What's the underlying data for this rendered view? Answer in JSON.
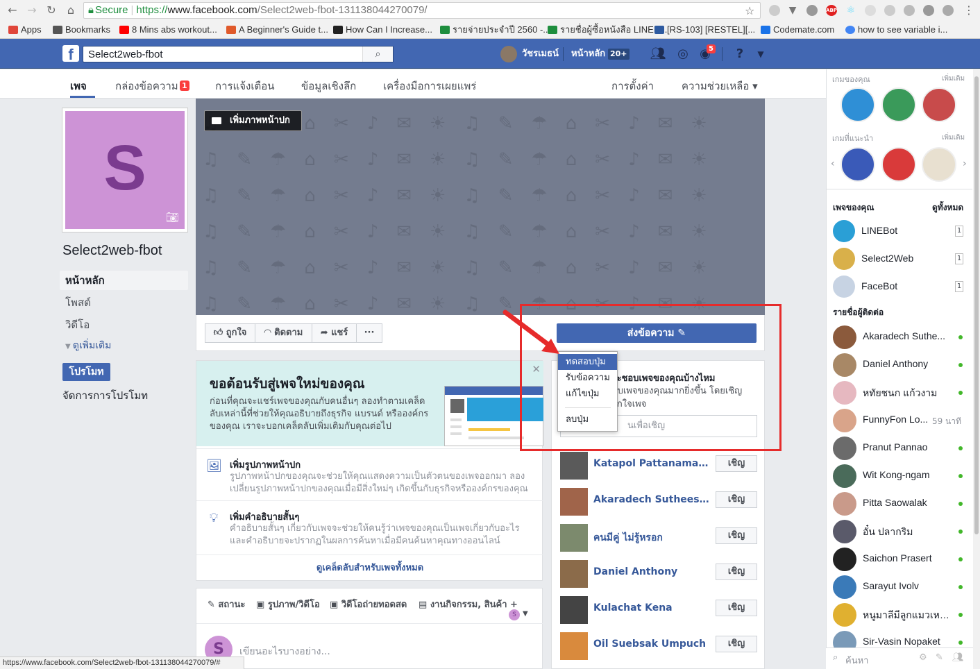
{
  "browser": {
    "secure_label": "Secure",
    "url_scheme": "https://",
    "url_host": "www.facebook.com",
    "url_path": "/Select2web-fbot-131138044270079/",
    "bookmarks": [
      {
        "label": "Apps",
        "color": "#e0463a"
      },
      {
        "label": "Bookmarks",
        "color": "#555555"
      },
      {
        "label": "8 Mins abs workout...",
        "color": "#ff0000"
      },
      {
        "label": "A Beginner's Guide t...",
        "color": "#e05a2b"
      },
      {
        "label": "How Can I Increase...",
        "color": "#222222"
      },
      {
        "label": "รายจ่ายประจำปี 2560 -...",
        "color": "#1e8e3e"
      },
      {
        "label": "รายชื่อผู้ซื้อหนังสือ LINEB...",
        "color": "#1e8e3e"
      },
      {
        "label": "[RS-103] [RESTEL][...",
        "color": "#2d5aa0"
      },
      {
        "label": "Codemate.com",
        "color": "#1a73e8"
      },
      {
        "label": "how to see variable i...",
        "color": "#4285f4"
      }
    ],
    "status_url": "https://www.facebook.com/Select2web-fbot-131138044270079/#"
  },
  "fb_header": {
    "search_value": "Select2web-fbot",
    "user_name": "วัชรเมธน์",
    "home_label": "หน้าหลัก",
    "home_badge": "20+",
    "notif_badge": "5",
    "brand_color": "#4267b2"
  },
  "page_nav": {
    "tabs": [
      {
        "label": "เพจ"
      },
      {
        "label": "กล่องข้อความ"
      },
      {
        "label": "การแจ้งเตือน"
      },
      {
        "label": "ข้อมูลเชิงลึก"
      },
      {
        "label": "เครื่องมือการเผยแพร่"
      }
    ],
    "inbox_badge": "1",
    "settings_label": "การตั้งค่า",
    "help_label": "ความช่วยเหลือ ▾"
  },
  "left": {
    "profile_letter": "S",
    "page_name": "Select2web-fbot",
    "nav": [
      "หน้าหลัก",
      "โพสต์",
      "วิดีโอ"
    ],
    "see_more": "ดูเพิ่มเติม",
    "promote_button": "โปรโมท",
    "manage_promotions": "จัดการการโปรโมท"
  },
  "cover": {
    "add_cover_label": "เพิ่มภาพหน้าปก"
  },
  "actions": {
    "like": "ถูกใจ",
    "follow": "ติดตาม",
    "share": "แชร์",
    "more": "···",
    "send_message": "ส่งข้อความ"
  },
  "dropdown": {
    "items": [
      "ทดสอบปุ่ม",
      "รับข้อความ",
      "แก้ไขปุ่ม",
      "ลบปุ่ม"
    ]
  },
  "welcome": {
    "title": "ขอต้อนรับสู่เพจใหม่ของคุณ",
    "text": "ก่อนที่คุณจะแชร์เพจของคุณกับคนอื่นๆ ลองทำตามเคล็ดลับเหล่านี้ที่ช่วยให้คุณอธิบายถึงธุรกิจ แบรนด์ หรือองค์กรของคุณ เราจะบอกเคล็ดลับเพิ่มเติมกับคุณต่อไป",
    "tips": [
      {
        "title": "เพิ่มรูปภาพหน้าปก",
        "desc": "รูปภาพหน้าปกของคุณจะช่วยให้คุณแสดงความเป็นตัวตนของเพจออกมา ลองเปลี่ยนรูปภาพหน้าปกของคุณเมื่อมีสิ่งใหม่ๆ เกิดขึ้นกับธุรกิจหรือองค์กรของคุณ"
      },
      {
        "title": "เพิ่มคำอธิบายสั้นๆ",
        "desc": "คำอธิบายสั้นๆ เกี่ยวกับเพจจะช่วยให้คนรู้ว่าเพจของคุณเป็นเพจเกี่ยวกับอะไร และคำอธิบายจะปรากฏในผลการค้นหาเมื่อมีคนค้นหาคุณทางออนไลน์"
      }
    ],
    "all_tips": "ดูเคล็ดลับสำหรับเพจทั้งหมด"
  },
  "composer": {
    "tabs": [
      "สถานะ",
      "รูปภาพ/วิดีโอ",
      "วิดีโอถ่ายทอดสด",
      "งานกิจกรรม, สินค้า +"
    ],
    "placeholder": "เขียนอะไรบางอย่าง...",
    "avatar_letter": "S"
  },
  "invite": {
    "title": "จะชอบเพจของคุณบ้างไหม",
    "desc": "พบเพจของคุณมากยิ่งขึ้น โดยเชิญถูกใจเพจ",
    "search_placeholder": "นเพื่อเชิญ",
    "button_label": "เชิญ",
    "friends": [
      {
        "name": "Katapol Pattanamanee",
        "color": "#5a5a5a"
      },
      {
        "name": "Akaradech Sutheesunt...",
        "color": "#a0644a"
      },
      {
        "name": "คนมีคู่ ไม่รู้หรอก",
        "color": "#7c8a6d"
      },
      {
        "name": "Daniel Anthony",
        "color": "#8b6b4a"
      },
      {
        "name": "Kulachat Kena",
        "color": "#444444"
      },
      {
        "name": "Oil Suebsak Umpuch",
        "color": "#d98a3d"
      }
    ]
  },
  "right": {
    "your_games": "เกมของคุณ",
    "suggested_games": "เกมที่แนะนำ",
    "more": "เพิ่มเติม",
    "your_pages": "เพจของคุณ",
    "see_all": "ดูทั้งหมด",
    "pages": [
      {
        "name": "LINEBot",
        "count": "1",
        "color": "#2a9fd6"
      },
      {
        "name": "Select2Web",
        "count": "1",
        "color": "#d9b04a"
      },
      {
        "name": "FaceBot",
        "count": "1",
        "color": "#c7d3e3"
      }
    ],
    "contacts_title": "รายชื่อผู้ติดต่อ",
    "contacts": [
      {
        "name": "Akaradech Suthe...",
        "color": "#8b5a3c"
      },
      {
        "name": "Daniel Anthony",
        "color": "#a88866"
      },
      {
        "name": "หทัยชนก แก้วงาม",
        "color": "#e6b8c0"
      },
      {
        "name": "FunnyFon Lo...",
        "color": "#d9a48a",
        "time": "59 นาที"
      },
      {
        "name": "Pranut Pannao",
        "color": "#6b6b6b"
      },
      {
        "name": "Wit Kong-ngam",
        "color": "#4a6b5a"
      },
      {
        "name": "Pitta Saowalak",
        "color": "#c99a8a"
      },
      {
        "name": "อั๋น ปลากริม",
        "color": "#5a5a6a"
      },
      {
        "name": "Saichon Prasert",
        "color": "#222222"
      },
      {
        "name": "Sarayut Ivolv",
        "color": "#3a7ab8"
      },
      {
        "name": "หนูมาลีมีลูกแมวเหมี...",
        "color": "#e0b030"
      },
      {
        "name": "Sir-Vasin Nopaket",
        "color": "#7a9ab8"
      }
    ],
    "search_placeholder": "ค้นหา"
  }
}
